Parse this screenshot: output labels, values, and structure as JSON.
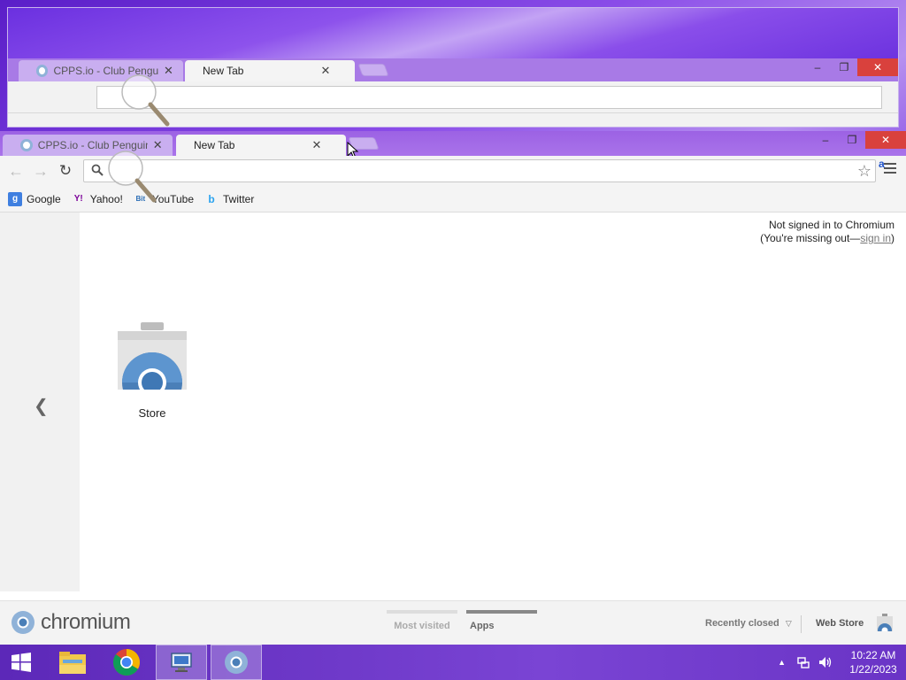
{
  "ghost_window": {
    "tabs": [
      {
        "title": "CPPS.io - Club Penguin P"
      },
      {
        "title": "New Tab"
      }
    ]
  },
  "window": {
    "tabs": [
      {
        "title": "CPPS.io - Club Penguin P",
        "active": false
      },
      {
        "title": "New Tab",
        "active": true
      }
    ],
    "controls": {
      "minimize": "–",
      "restore": "❐",
      "close": "✕"
    }
  },
  "toolbar": {
    "omnibox_value": "",
    "extension_label": "a"
  },
  "bookmarks": [
    {
      "label": "Google",
      "icon": "google-icon",
      "glyph": "g",
      "color": "#3f7fe0"
    },
    {
      "label": "Yahoo!",
      "icon": "yahoo-icon",
      "glyph": "Y!",
      "color": "#7b0099"
    },
    {
      "label": "YouTube",
      "icon": "bitview-icon",
      "glyph": "Bit",
      "color": "#2a6db5"
    },
    {
      "label": "Twitter",
      "icon": "twitter-icon",
      "glyph": "b",
      "color": "#2aa3ef"
    }
  ],
  "ntp": {
    "signin_line1": "Not signed in to Chromium",
    "signin_prefix": "(You're missing out—",
    "signin_link": "sign in",
    "signin_suffix": ")",
    "apps": [
      {
        "label": "Store",
        "icon": "webstore-icon"
      }
    ],
    "footer": {
      "brand": "chromium",
      "pages": [
        {
          "label": "Most visited",
          "active": false
        },
        {
          "label": "Apps",
          "active": true
        }
      ],
      "recently_closed": "Recently closed",
      "web_store": "Web Store"
    }
  },
  "taskbar": {
    "time": "10:22 AM",
    "date": "1/22/2023",
    "items": [
      "windows-start-icon",
      "file-explorer-icon",
      "chrome-icon",
      "remote-desktop-icon",
      "chromium-icon"
    ]
  },
  "colors": {
    "accent_purple": "#9c62e4",
    "close_red": "#d9413d",
    "link_gray": "#777777"
  }
}
